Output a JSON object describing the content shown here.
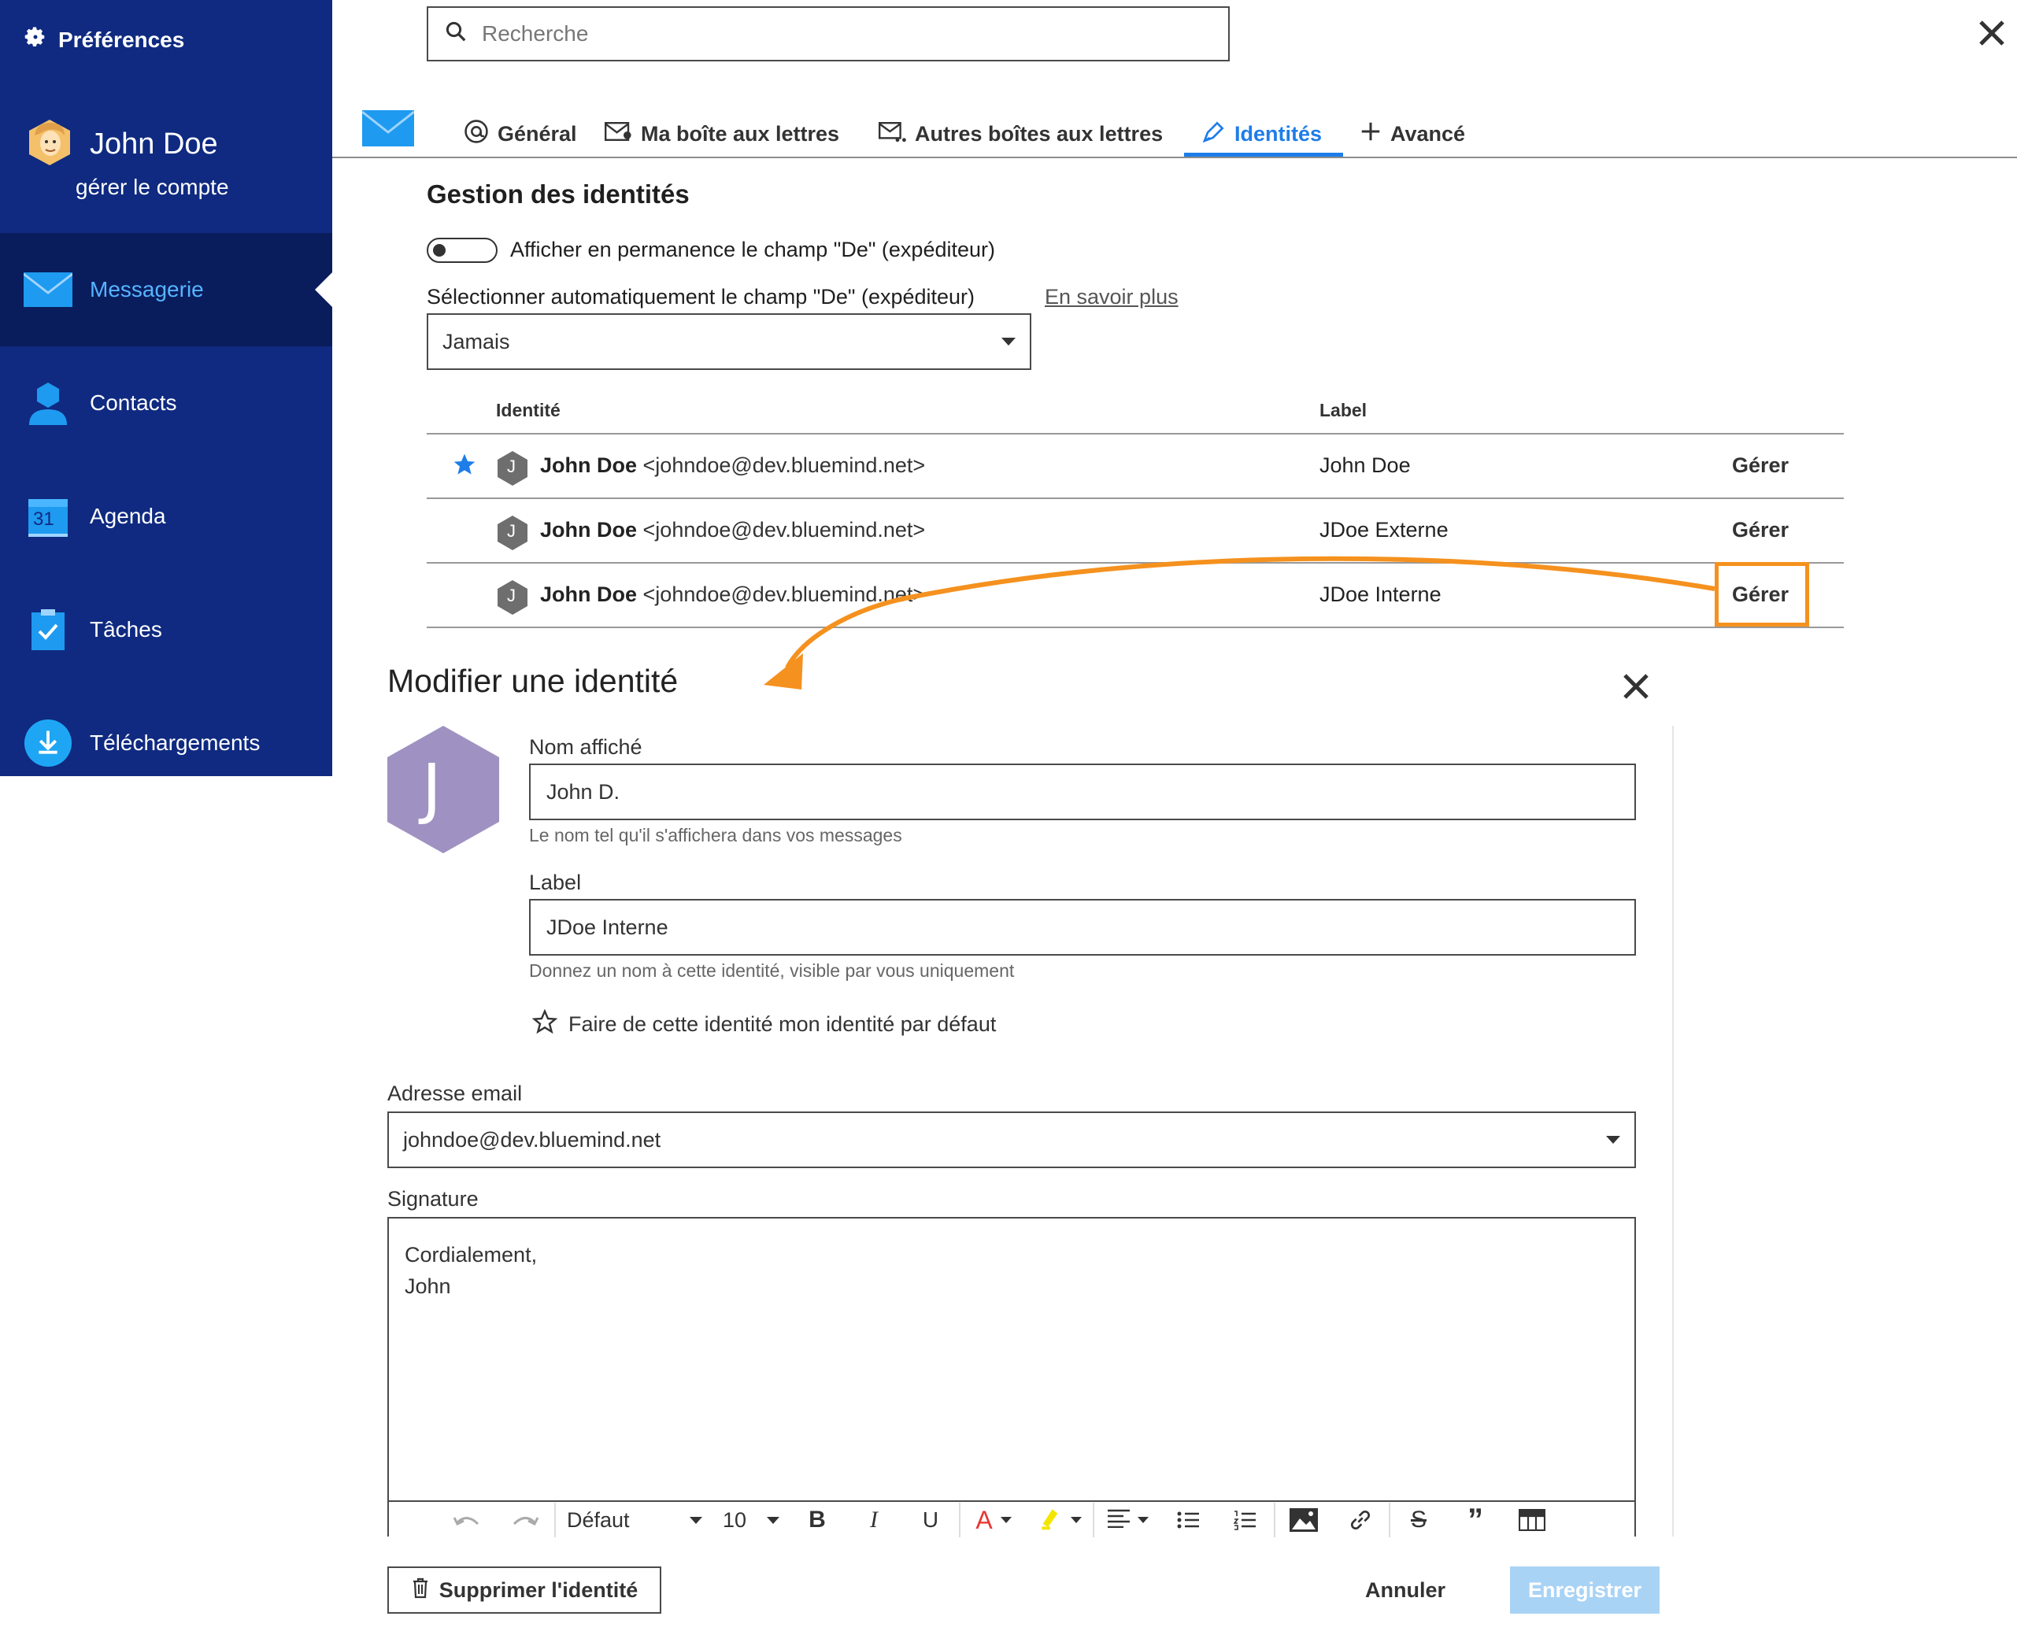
{
  "sidebar": {
    "preferences_label": "Préférences",
    "user_name": "John Doe",
    "manage_account": "gérer le compte",
    "items": [
      {
        "label": "Messagerie",
        "active": true
      },
      {
        "label": "Contacts"
      },
      {
        "label": "Agenda",
        "icon_text": "31"
      },
      {
        "label": "Tâches"
      },
      {
        "label": "Téléchargements"
      }
    ]
  },
  "search": {
    "placeholder": "Recherche"
  },
  "tabs": [
    {
      "label": "Général"
    },
    {
      "label": "Ma boîte aux lettres"
    },
    {
      "label": "Autres boîtes aux lettres"
    },
    {
      "label": "Identités",
      "active": true
    },
    {
      "label": "Avancé"
    }
  ],
  "identities": {
    "heading": "Gestion des identités",
    "toggle_label": "Afficher en permanence le champ \"De\" (expéditeur)",
    "auto_select_label": "Sélectionner automatiquement le champ \"De\" (expéditeur)",
    "learn_more": "En savoir plus",
    "auto_select_value": "Jamais",
    "table": {
      "col_identity": "Identité",
      "col_label": "Label",
      "rows": [
        {
          "avatar": "J",
          "name": "John Doe",
          "email": "<johndoe@dev.bluemind.net>",
          "label": "John Doe",
          "action": "Gérer",
          "default": true
        },
        {
          "avatar": "J",
          "name": "John Doe",
          "email": "<johndoe@dev.bluemind.net>",
          "label": "JDoe Externe",
          "action": "Gérer"
        },
        {
          "avatar": "J",
          "name": "John Doe",
          "email": "<johndoe@dev.bluemind.net>",
          "label": "JDoe Interne",
          "action": "Gérer"
        }
      ]
    }
  },
  "modal": {
    "title": "Modifier une identité",
    "avatar_letter": "J",
    "display_name_label": "Nom affiché",
    "display_name_value": "John D.",
    "display_name_hint": "Le nom tel qu'il s'affichera dans vos messages",
    "label_label": "Label",
    "label_value": "JDoe Interne",
    "label_hint": "Donnez un nom à cette identité, visible par vous uniquement",
    "default_checkbox_label": "Faire de cette identité mon identité par défaut",
    "email_label": "Adresse email",
    "email_value": "johndoe@dev.bluemind.net",
    "signature_label": "Signature",
    "signature_line1": "Cordialement,",
    "signature_line2": "John",
    "toolbar": {
      "font": "Défaut",
      "size": "10"
    },
    "delete_button": "Supprimer l'identité",
    "cancel_button": "Annuler",
    "save_button": "Enregistrer"
  },
  "colors": {
    "sidebar_bg": "#0f2a80",
    "sidebar_active_bg": "#091c5c",
    "accent_blue": "#1e7de8",
    "annotation_orange": "#f5911e",
    "avatar_purple": "#9f92c2",
    "save_button_bg": "#a9d3f5"
  }
}
